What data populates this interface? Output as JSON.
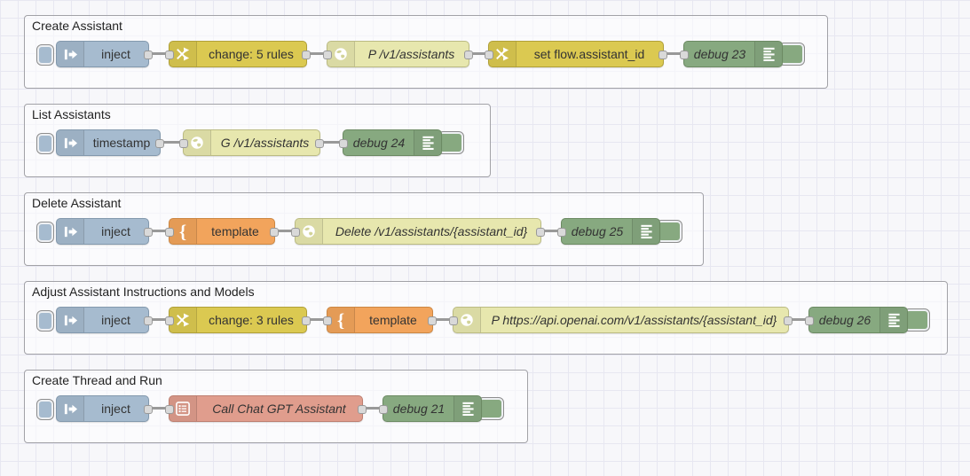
{
  "app": "node-red-flow-editor",
  "palette": {
    "inject_node": "#a6bbcf",
    "change_node": "#dbc951",
    "http_request_node": "#e7e7ae",
    "template_node": "#f2a45c",
    "debug_node": "#87a980",
    "subflow_node": "#e09d8d",
    "wire": "#999999",
    "port": "#d9d9d9",
    "group_border": "#a2a2a7",
    "canvas_grid": "#e7e7f1"
  },
  "icons": {
    "inject": "arrow-into-bar-icon",
    "change": "shuffle-arrows-icon",
    "http": "globe-icon",
    "template": "curly-brace-icon",
    "debug": "list-lines-icon",
    "subflow": "mini-flow-icon"
  },
  "groups": [
    {
      "label": "Create Assistant",
      "nodes": [
        {
          "type": "inject",
          "label": "inject"
        },
        {
          "type": "change",
          "label": "change: 5 rules"
        },
        {
          "type": "http request",
          "label": "P /v1/assistants"
        },
        {
          "type": "change",
          "label": "set flow.assistant_id"
        },
        {
          "type": "debug",
          "label": "debug 23"
        }
      ]
    },
    {
      "label": "List Assistants",
      "nodes": [
        {
          "type": "inject",
          "label": "timestamp"
        },
        {
          "type": "http request",
          "label": "G /v1/assistants"
        },
        {
          "type": "debug",
          "label": "debug 24"
        }
      ]
    },
    {
      "label": "Delete Assistant",
      "nodes": [
        {
          "type": "inject",
          "label": "inject"
        },
        {
          "type": "template",
          "label": "template"
        },
        {
          "type": "http request",
          "label": "Delete /v1/assistants/{assistant_id}"
        },
        {
          "type": "debug",
          "label": "debug 25"
        }
      ]
    },
    {
      "label": "Adjust Assistant Instructions and Models",
      "nodes": [
        {
          "type": "inject",
          "label": "inject"
        },
        {
          "type": "change",
          "label": "change: 3 rules"
        },
        {
          "type": "template",
          "label": "template"
        },
        {
          "type": "http request",
          "label": "P https://api.openai.com/v1/assistants/{assistant_id}"
        },
        {
          "type": "debug",
          "label": "debug 26"
        }
      ]
    },
    {
      "label": "Create Thread and Run",
      "nodes": [
        {
          "type": "inject",
          "label": "inject"
        },
        {
          "type": "subflow",
          "label": "Call Chat GPT Assistant"
        },
        {
          "type": "debug",
          "label": "debug 21"
        }
      ]
    }
  ]
}
